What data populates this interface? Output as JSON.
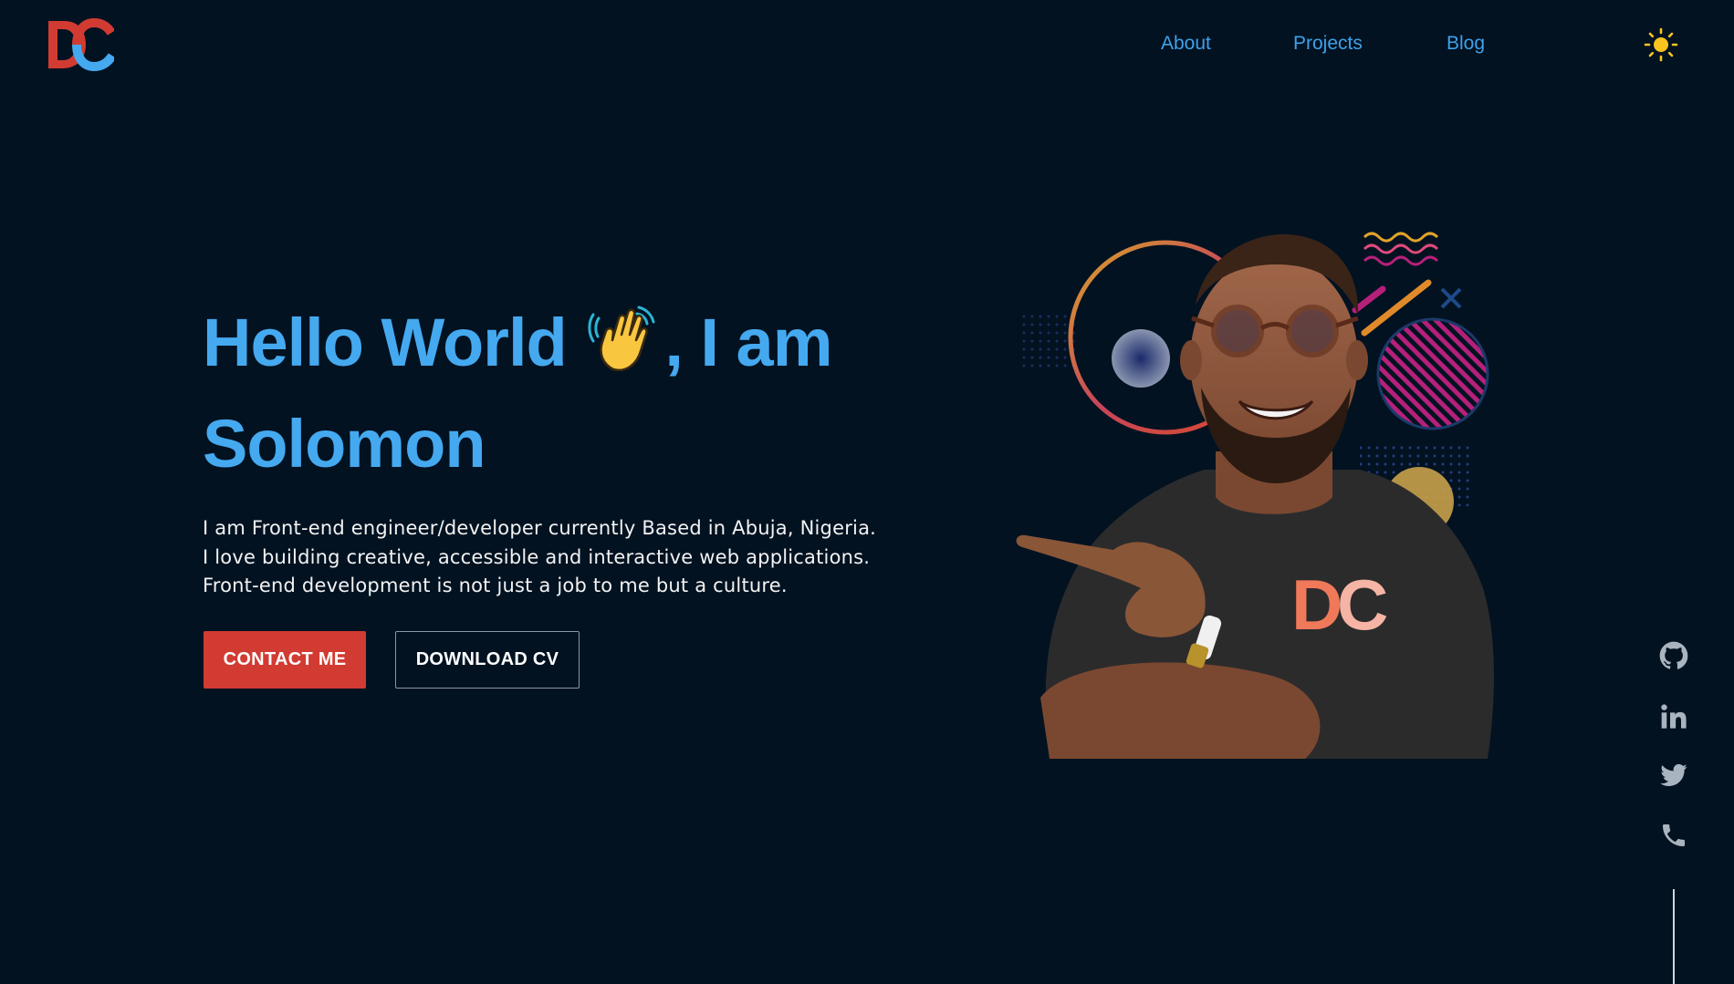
{
  "header": {
    "logo_text": "DC",
    "nav": [
      {
        "label": "About"
      },
      {
        "label": "Projects"
      },
      {
        "label": "Blog"
      }
    ],
    "theme_toggle_icon": "sun-icon"
  },
  "hero": {
    "title_part1": "Hello World ",
    "title_emoji": "waving-hand-icon",
    "title_part2": ", I am Solomon",
    "description": [
      "I am Front-end engineer/developer currently Based in Abuja, Nigeria.",
      "I love building creative, accessible and interactive web applications.",
      "Front-end development is not just a job to me but a culture."
    ],
    "contact_label": "CONTACT ME",
    "cv_label": "DOWNLOAD CV"
  },
  "social": [
    {
      "icon": "github-icon"
    },
    {
      "icon": "linkedin-icon"
    },
    {
      "icon": "twitter-icon"
    },
    {
      "icon": "phone-icon"
    }
  ],
  "colors": {
    "background": "#021221",
    "accent_blue": "#45a9f0",
    "accent_red": "#d13b32",
    "sun": "#f7c51e"
  }
}
